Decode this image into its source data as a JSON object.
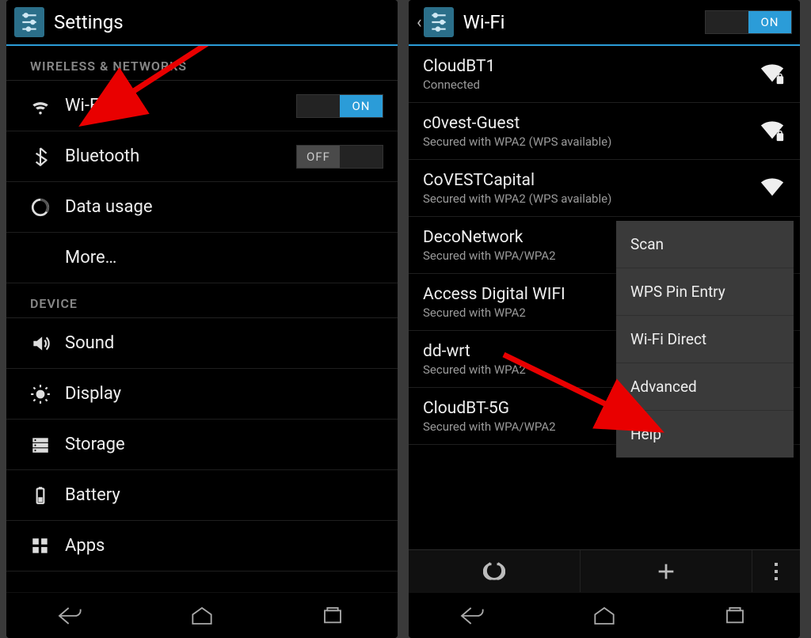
{
  "left": {
    "title": "Settings",
    "sections": [
      {
        "header": "WIRELESS & NETWORKS",
        "items": [
          {
            "label": "Wi-Fi",
            "toggle": "ON",
            "iconName": "wifi-icon"
          },
          {
            "label": "Bluetooth",
            "toggle": "OFF",
            "iconName": "bluetooth-icon"
          },
          {
            "label": "Data usage",
            "iconName": "data-usage-icon"
          },
          {
            "label": "More…",
            "iconName": ""
          }
        ]
      },
      {
        "header": "DEVICE",
        "items": [
          {
            "label": "Sound",
            "iconName": "sound-icon"
          },
          {
            "label": "Display",
            "iconName": "display-icon"
          },
          {
            "label": "Storage",
            "iconName": "storage-icon"
          },
          {
            "label": "Battery",
            "iconName": "battery-icon"
          },
          {
            "label": "Apps",
            "iconName": "apps-icon"
          }
        ]
      }
    ]
  },
  "right": {
    "title": "Wi-Fi",
    "headerToggle": "ON",
    "networks": [
      {
        "ssid": "CloudBT1",
        "status": "Connected",
        "secure": true
      },
      {
        "ssid": "c0vest-Guest",
        "status": "Secured with WPA2 (WPS available)",
        "secure": true
      },
      {
        "ssid": "CoVESTCapital",
        "status": "Secured with WPA2 (WPS available)",
        "secure": true
      },
      {
        "ssid": "DecoNetwork",
        "status": "Secured with WPA/WPA2",
        "secure": true
      },
      {
        "ssid": "Access Digital WIFI",
        "status": "Secured with WPA2",
        "secure": true
      },
      {
        "ssid": "dd-wrt",
        "status": "Secured with WPA2",
        "secure": true
      },
      {
        "ssid": "CloudBT-5G",
        "status": "Secured with WPA/WPA2",
        "secure": true
      }
    ],
    "popup": {
      "items": [
        "Scan",
        "WPS Pin Entry",
        "Wi-Fi Direct",
        "Advanced",
        "Help"
      ]
    }
  },
  "toggleLabels": {
    "on": "ON",
    "off": "OFF"
  }
}
